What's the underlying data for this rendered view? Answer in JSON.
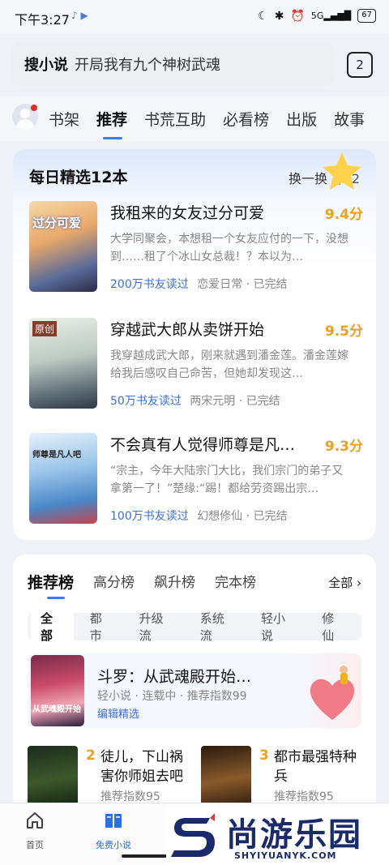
{
  "status_bar": {
    "time": "下午3:27",
    "network": "5G",
    "battery": "67"
  },
  "search": {
    "brand": "搜小说",
    "query": "开局我有九个神树武魂",
    "tab_count": "2"
  },
  "top_nav": {
    "tabs": [
      "书架",
      "推荐",
      "书荒互助",
      "必看榜",
      "出版",
      "故事"
    ],
    "active_index": 1
  },
  "daily": {
    "title": "每日精选12本",
    "swap_label": "换一换",
    "swap_count": "3/12",
    "books": [
      {
        "title": "我租来的女友过分可爱",
        "score": "9.4分",
        "desc": "大学同聚会，本想租一个女友应付的一下，没想到……租了个冰山女总裁！？本以为…",
        "readers": "200万书友读过",
        "genre": "恋爱日常",
        "status": "已完结",
        "cover_text": "过分可爱"
      },
      {
        "title": "穿越武大郎从卖饼开始",
        "score": "9.5分",
        "desc": "我穿越成武大郎，刚来就遇到潘金莲。潘金莲嫁给我后感叹自己命苦，但她却发现这…",
        "readers": "50万书友读过",
        "genre": "两宋元明",
        "status": "已完结",
        "cover_text": "原创"
      },
      {
        "title": "不会真有人觉得师尊是凡…",
        "score": "9.3分",
        "desc": "“宗主，今年大陆宗门大比，我们宗门的弟子又拿第一了！”楚缘:“踢！都给劳资踢出宗…",
        "readers": "100万书友读过",
        "genre": "幻想修仙",
        "status": "已完结",
        "cover_text": "师尊是凡人吧"
      }
    ]
  },
  "ranking": {
    "tabs": [
      "推荐榜",
      "高分榜",
      "飙升榜",
      "完本榜"
    ],
    "all_label": "全部",
    "filters": [
      "全部",
      "都市",
      "升级流",
      "系统流",
      "轻小说",
      "修仙"
    ],
    "featured": {
      "title": "斗罗：从武魂殿开始…",
      "meta": "轻小说 · 连载中 · 推荐指数99",
      "tag": "编辑精选",
      "cover_text": "从武魂殿开始"
    },
    "items": [
      {
        "rank": "2",
        "title": "徒儿，下山祸害你师姐去吧",
        "score": "推荐指数95"
      },
      {
        "rank": "3",
        "title": "都市最强特种兵",
        "score": "推荐指数95"
      }
    ]
  },
  "bottom_nav": {
    "items": [
      "首页",
      "免费小说"
    ]
  },
  "watermark": {
    "text": "尚游乐园",
    "url": "SHYIYUANYK.COM"
  },
  "colors": {
    "accent": "#3b7cf2",
    "score": "#f0a020",
    "readers": "#3b6fd6"
  }
}
